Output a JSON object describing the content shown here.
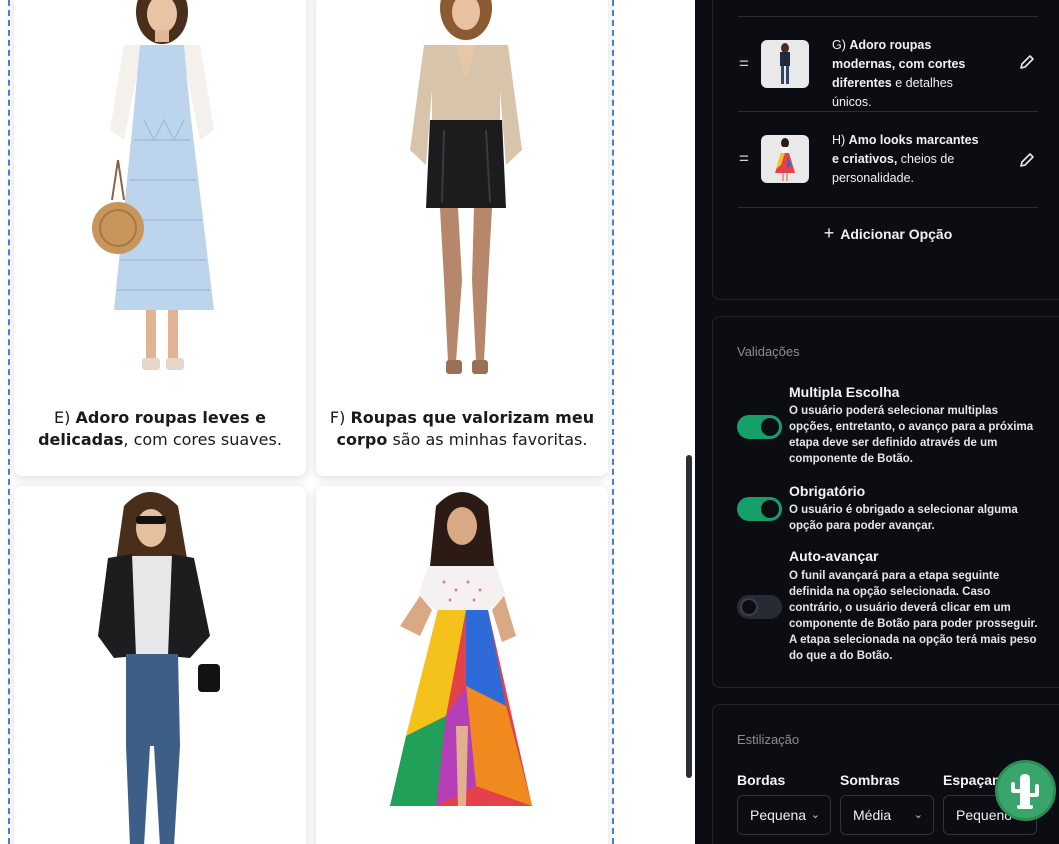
{
  "canvas": {
    "cards": [
      {
        "prefix": "E) ",
        "bold": "Adoro roupas leves e delicadas",
        "suffix": ", com cores suaves."
      },
      {
        "prefix": "F) ",
        "bold": "Roupas que valorizam meu corpo",
        "suffix": " são as minhas favoritas."
      }
    ]
  },
  "options": {
    "items": [
      {
        "prefix": "G) ",
        "bold": "Adoro roupas modernas, com cortes diferentes",
        "suffix": " e detalhes únicos."
      },
      {
        "prefix": "H) ",
        "bold": "Amo looks marcantes e criativos,",
        "suffix": " cheios de personalidade."
      }
    ],
    "add_label": "Adicionar Opção",
    "add_icon": "+"
  },
  "validations": {
    "title": "Validações",
    "items": [
      {
        "title": "Multipla Escolha",
        "enabled": true,
        "desc": "O usuário poderá selecionar multiplas opções, entretanto, o avanço para a próxima etapa deve ser definido através de um componente de Botão."
      },
      {
        "title": "Obrigatório",
        "enabled": true,
        "desc": "O usuário é obrigado a selecionar alguma opção para poder avançar."
      },
      {
        "title": "Auto-avançar",
        "enabled": false,
        "desc": "O funil avançará para a etapa seguinte definida na opção selecionada. Caso contrário, o usuário deverá clicar em um componente de Botão para poder prosseguir. A etapa selecionada na opção terá mais peso do que a do Botão."
      }
    ]
  },
  "styling": {
    "title": "Estilização",
    "borders": {
      "label": "Bordas",
      "value": "Pequena"
    },
    "shadows": {
      "label": "Sombras",
      "value": "Média"
    },
    "spacing": {
      "label": "Espaçamento",
      "value": "Pequeno"
    }
  },
  "colors": {
    "accent": "#15a06a",
    "sidebar_bg": "#0b0d12",
    "guide": "#4c7fd6"
  }
}
